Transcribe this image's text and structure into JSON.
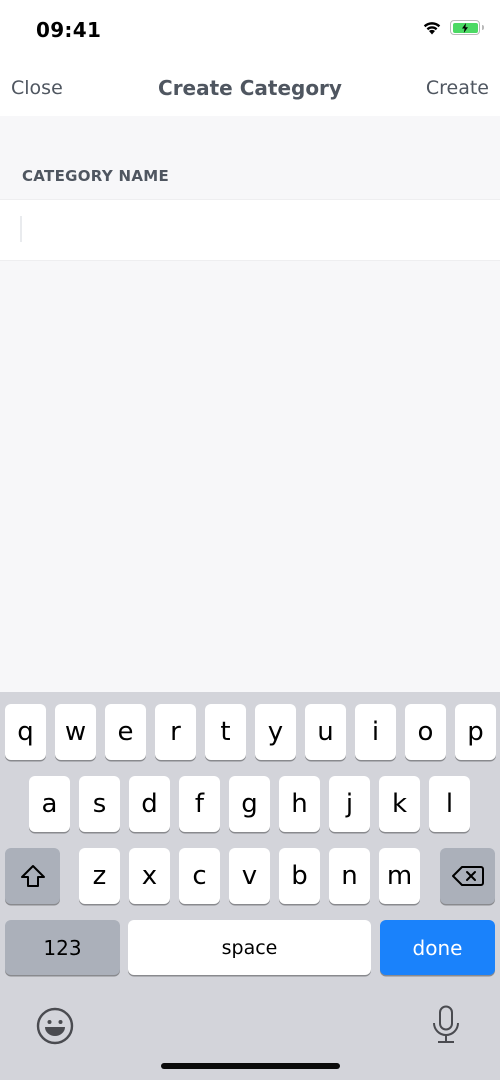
{
  "status_bar": {
    "time": "09:41",
    "battery_color": "#4cd964"
  },
  "nav": {
    "close_label": "Close",
    "title": "Create Category",
    "create_label": "Create"
  },
  "form": {
    "section_label": "CATEGORY NAME",
    "input_value": "",
    "input_placeholder": ""
  },
  "keyboard": {
    "row1": [
      "q",
      "w",
      "e",
      "r",
      "t",
      "y",
      "u",
      "i",
      "o",
      "p"
    ],
    "row2": [
      "a",
      "s",
      "d",
      "f",
      "g",
      "h",
      "j",
      "k",
      "l"
    ],
    "row3": [
      "z",
      "x",
      "c",
      "v",
      "b",
      "n",
      "m"
    ],
    "numbers_label": "123",
    "space_label": "space",
    "done_label": "done",
    "done_color": "#1a82fb"
  }
}
